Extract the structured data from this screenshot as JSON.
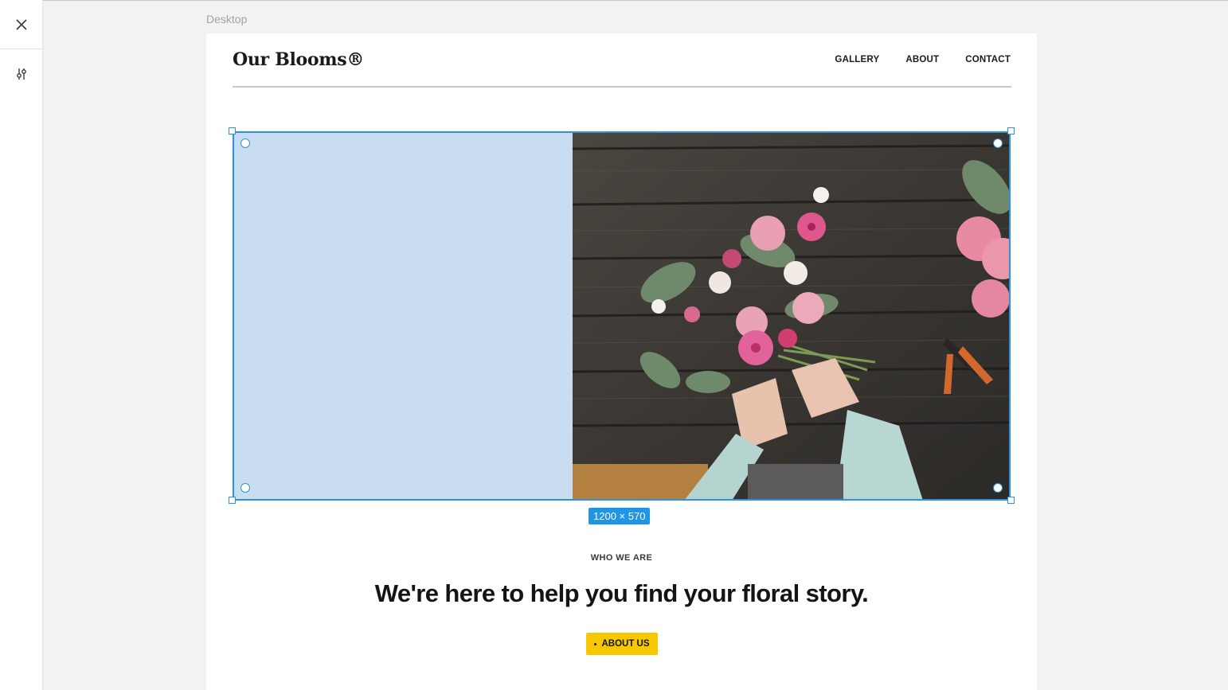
{
  "editor": {
    "close_icon": "close-icon",
    "settings_icon": "sliders-icon",
    "device_label": "Desktop"
  },
  "site": {
    "logo": "Our Blooms®",
    "nav": [
      "GALLERY",
      "ABOUT",
      "CONTACT"
    ]
  },
  "hero": {
    "size_label": "1200 × 570",
    "image_subject": "hands arranging pink flower bouquet on dark wooden table",
    "placeholder_color": "#c8ddef",
    "selection_color": "#2b93dc"
  },
  "about_section": {
    "eyebrow": "WHO WE ARE",
    "headline": "We're here to help you find your floral story.",
    "button_label": "ABOUT US",
    "button_color": "#f7c800"
  }
}
